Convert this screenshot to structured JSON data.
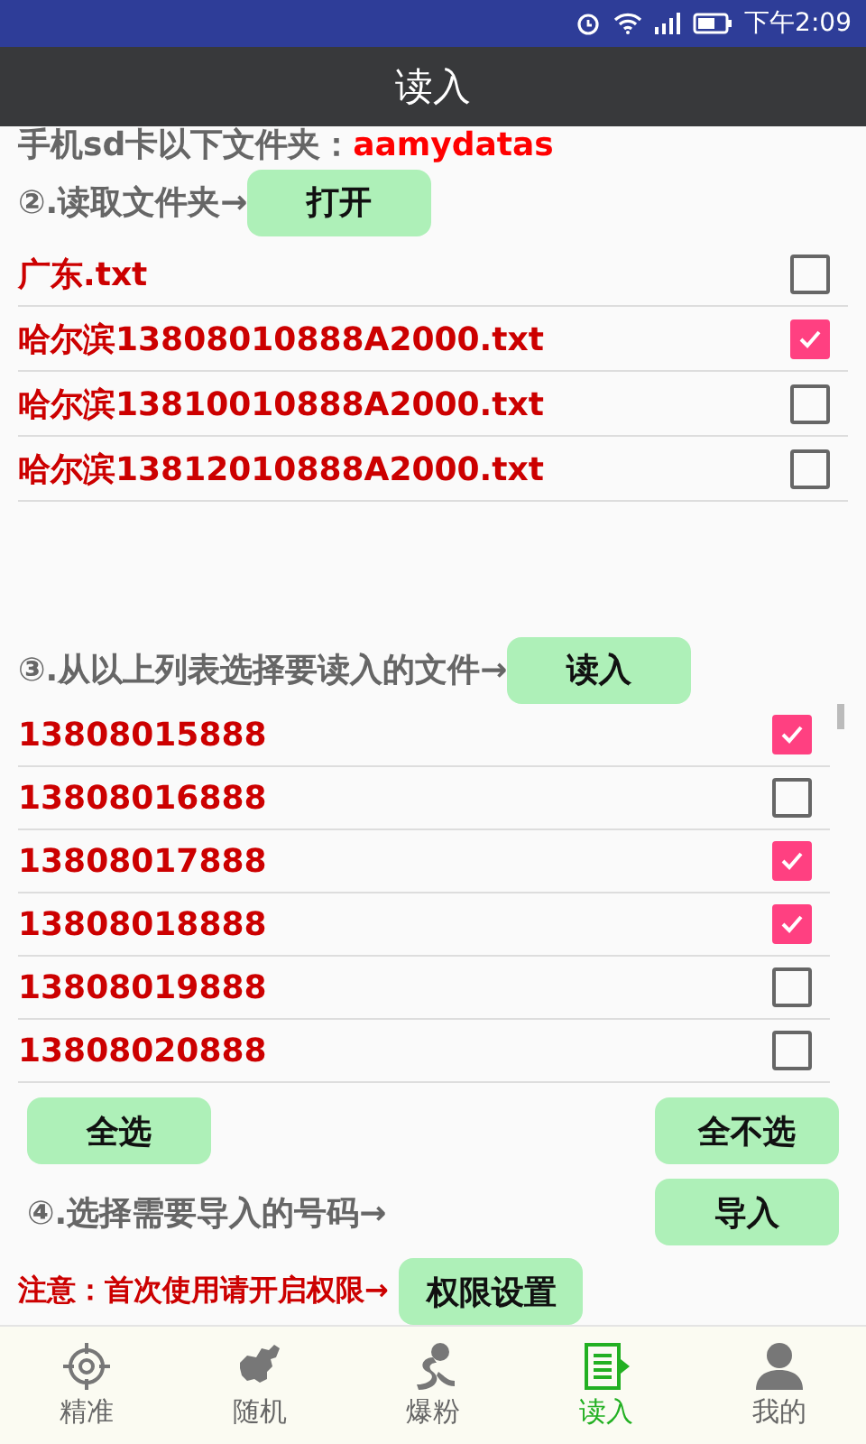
{
  "status_bar": {
    "time": "下午2:09"
  },
  "title": "读入",
  "folder_line": {
    "label": "手机sd卡以下文件夹：",
    "folder": "aamydatas"
  },
  "step2": {
    "label": "②.读取文件夹→",
    "button": "打开"
  },
  "files": [
    {
      "name": "广东.txt",
      "checked": false
    },
    {
      "name": "哈尔滨13808010888A2000.txt",
      "checked": true
    },
    {
      "name": "哈尔滨13810010888A2000.txt",
      "checked": false
    },
    {
      "name": "哈尔滨13812010888A2000.txt",
      "checked": false
    }
  ],
  "step3": {
    "label": "③.从以上列表选择要读入的文件→",
    "button": "读入"
  },
  "numbers": [
    {
      "number": "13808015888",
      "checked": true
    },
    {
      "number": "13808016888",
      "checked": false
    },
    {
      "number": "13808017888",
      "checked": true
    },
    {
      "number": "13808018888",
      "checked": true
    },
    {
      "number": "13808019888",
      "checked": false
    },
    {
      "number": "13808020888",
      "checked": false
    }
  ],
  "select_all": "全选",
  "select_none": "全不选",
  "step4": {
    "label": "④.选择需要导入的号码→",
    "button": "导入"
  },
  "notice": {
    "label": "注意：首次使用请开启权限→",
    "button": "权限设置"
  },
  "nav": [
    {
      "label": "精准",
      "selected": false
    },
    {
      "label": "随机",
      "selected": false
    },
    {
      "label": "爆粉",
      "selected": false
    },
    {
      "label": "读入",
      "selected": true
    },
    {
      "label": "我的",
      "selected": false
    }
  ]
}
